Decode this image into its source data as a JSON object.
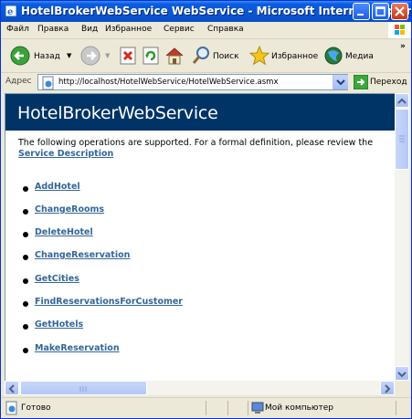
{
  "window": {
    "title": "HotelBrokerWebService WebService - Microsoft Internet Explorer"
  },
  "menu": {
    "items": [
      "Файл",
      "Правка",
      "Вид",
      "Избранное",
      "Сервис",
      "Справка"
    ]
  },
  "toolbar": {
    "back_label": "Назад",
    "search_label": "Поиск",
    "favorites_label": "Избранное",
    "media_label": "Медиа"
  },
  "address": {
    "label": "Адрес",
    "url": "http://localhost/HotelWebService/HotelWebService.asmx",
    "go_label": "Переход"
  },
  "page": {
    "heading": "HotelBrokerWebService",
    "intro": "The following operations are supported. For a formal definition, please review the",
    "description_link": "Service Description",
    "operations": [
      "AddHotel",
      "ChangeRooms",
      "DeleteHotel",
      "ChangeReservation",
      "GetCities",
      "FindReservationsForCustomer",
      "GetHotels",
      "MakeReservation"
    ]
  },
  "status": {
    "text": "Готово",
    "zone": "Мой компьютер"
  },
  "icons": {
    "title": "ie-icon",
    "back": "back-arrow-icon",
    "forward": "forward-arrow-icon",
    "stop": "stop-icon",
    "refresh": "refresh-icon",
    "home": "home-icon",
    "search": "search-icon",
    "favorites": "favorites-star-icon",
    "media": "media-icon",
    "go": "go-arrow-icon",
    "page": "page-icon",
    "computer": "computer-icon"
  },
  "colors": {
    "titlebar": "#0a5ce0",
    "heading_band": "#003366",
    "link": "#336699"
  }
}
